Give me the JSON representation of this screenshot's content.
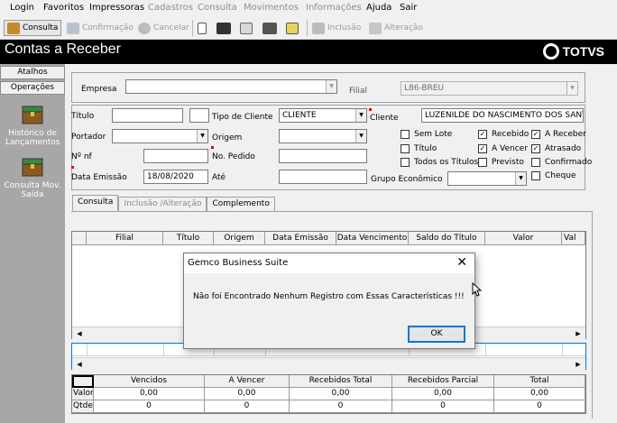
{
  "menu": [
    "Login",
    "Favoritos",
    "Impressoras",
    "Cadastros",
    "Consulta",
    "Movimentos",
    "Informações",
    "Ajuda",
    "Sair"
  ],
  "menu_disabled": [
    false,
    false,
    false,
    true,
    true,
    true,
    true,
    false,
    false
  ],
  "toolbar": {
    "consulta": "Consulta",
    "confirmacao": "Confirmação",
    "cancelar": "Cancelar",
    "inclusao": "Inclusão",
    "alteracao": "Alteração"
  },
  "window_title": "Contas a Receber",
  "logo_text": "TOTVS",
  "sidebar": {
    "atalhos": "Atalhos",
    "operacoes": "Operações",
    "items": [
      {
        "label": "Histórico de Lançamentos"
      },
      {
        "label": "Consulta Mov. Saída"
      }
    ]
  },
  "form": {
    "empresa_label": "Empresa",
    "empresa_value": "",
    "filial_label": "Filial",
    "filial_value": "L86-BREU",
    "titulo_label": "Título",
    "titulo_value": "",
    "titulo_value2": "",
    "tipo_cliente_label": "Tipo de Cliente",
    "tipo_cliente_value": "CLIENTE",
    "cliente_label": "Cliente",
    "cliente_value": "LUZENILDE DO NASCIMENTO DOS SANT",
    "portador_label": "Portador",
    "portador_value": "",
    "origem_label": "Origem",
    "origem_value": "",
    "nf_label": "Nº nf",
    "nf_value": "",
    "pedido_label": "No. Pedido",
    "pedido_value": "",
    "data_emissao_label": "Data Emissão",
    "data_emissao_value": "18/08/2020",
    "ate_label": "Até",
    "ate_value": "",
    "grupo_label": "Grupo Econômico",
    "grupo_value": ""
  },
  "checkboxes": [
    {
      "label": "Sem Lote",
      "checked": false
    },
    {
      "label": "Recebido",
      "checked": true
    },
    {
      "label": "A Receber",
      "checked": true
    },
    {
      "label": "Título",
      "checked": false
    },
    {
      "label": "A Vencer",
      "checked": true
    },
    {
      "label": "Atrasado",
      "checked": true
    },
    {
      "label": "Todos os Títulos",
      "checked": false
    },
    {
      "label": "Previsto",
      "checked": false
    },
    {
      "label": "Confirmado",
      "checked": false
    },
    {
      "label": "Cheque",
      "checked": false
    }
  ],
  "tabs": [
    "Consulta",
    "Inclusão /Alteração",
    "Complemento"
  ],
  "grid_columns": [
    "",
    "Filial",
    "Título",
    "Origem",
    "Data Emissão",
    "Data Vencimento",
    "Saldo do Título",
    "Valor",
    "Val"
  ],
  "totals": {
    "columns": [
      "",
      "Vencidos",
      "A Vencer",
      "Recebidos Total",
      "Recebidos Parcial",
      "Total"
    ],
    "rows": [
      {
        "label": "Valor",
        "values": [
          "0,00",
          "0,00",
          "0,00",
          "0,00",
          "0,00"
        ]
      },
      {
        "label": "Qtde",
        "values": [
          "0",
          "0",
          "0",
          "0",
          "0"
        ]
      }
    ]
  },
  "dialog": {
    "title": "Gemco Business Suite",
    "message": "Não foi Encontrado Nenhum Registro com Essas Características !!!",
    "ok_label": "OK",
    "close_glyph": "✕"
  },
  "glyphs": {
    "dropdown": "▼",
    "left": "◀",
    "right": "▶",
    "check": "✓"
  }
}
